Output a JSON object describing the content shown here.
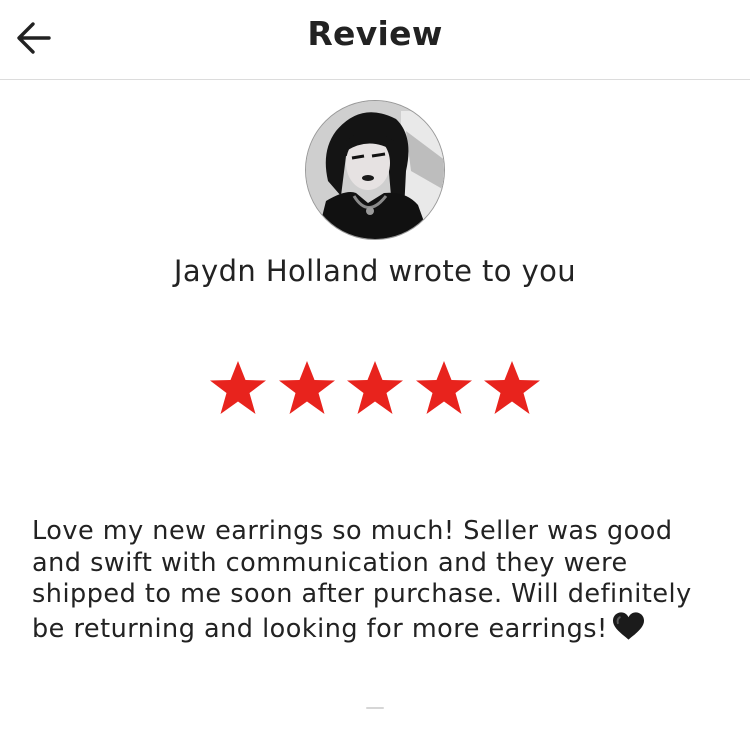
{
  "header": {
    "title": "Review",
    "back_icon": "arrow-left-icon"
  },
  "reviewer": {
    "name": "Jaydn Holland",
    "headline": "Jaydn Holland wrote to you",
    "avatar_icon": "user-avatar-photo"
  },
  "rating": {
    "value": 5,
    "max": 5,
    "star_color": "#e8231d"
  },
  "review": {
    "text": "Love my new earrings so much! Seller was good and swift with communication and they were shipped to me soon after purchase. Will definitely be returning and looking for more earrings!",
    "emoji": "black-heart-icon"
  }
}
